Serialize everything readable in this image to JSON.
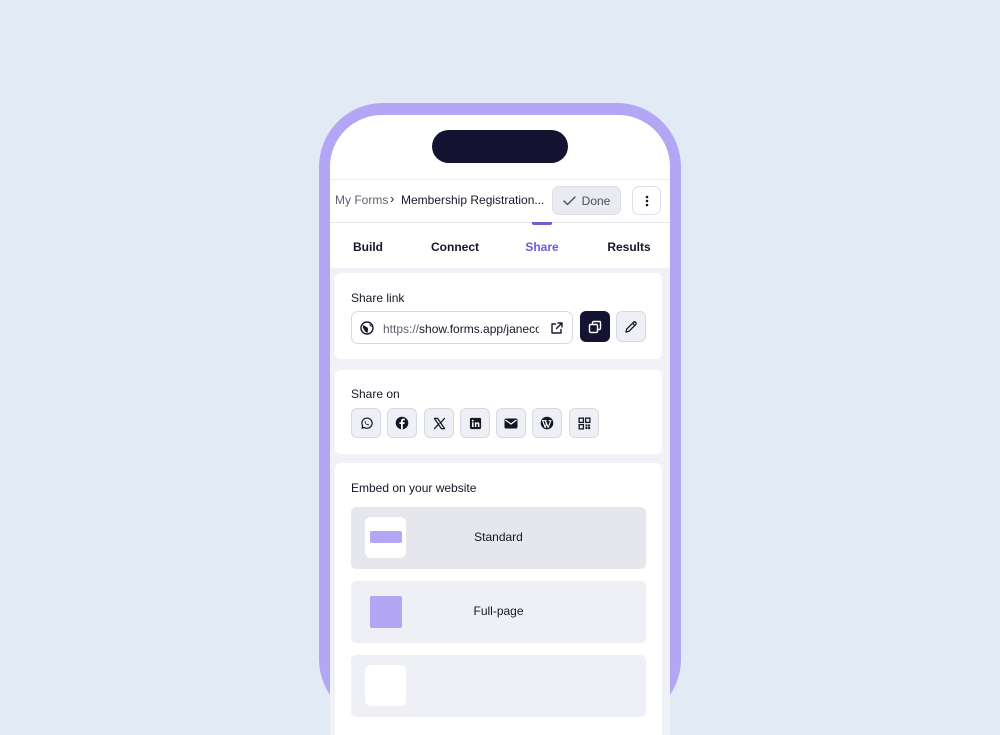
{
  "header": {
    "breadcrumb_root": "My Forms",
    "breadcrumb_separator": "›",
    "breadcrumb_current": "Membership Registration...",
    "done_label": "Done"
  },
  "tabs": [
    {
      "label": "Build",
      "active": false
    },
    {
      "label": "Connect",
      "active": false
    },
    {
      "label": "Share",
      "active": true
    },
    {
      "label": "Results",
      "active": false
    }
  ],
  "share_link": {
    "title": "Share link",
    "url_scheme": "https://",
    "url_rest": "show.forms.app/janeco"
  },
  "share_on": {
    "title": "Share on",
    "icons": [
      "whatsapp-icon",
      "facebook-icon",
      "x-icon",
      "linkedin-icon",
      "email-icon",
      "wordpress-icon",
      "qr-code-icon"
    ]
  },
  "embed": {
    "title": "Embed on your website",
    "options": [
      {
        "label": "Standard",
        "selected": true
      },
      {
        "label": "Full-page",
        "selected": false
      }
    ]
  },
  "colors": {
    "background": "#e1eaf5",
    "phone_frame": "#b2a6f5",
    "accent": "#6e5bd6",
    "dark": "#141331"
  }
}
